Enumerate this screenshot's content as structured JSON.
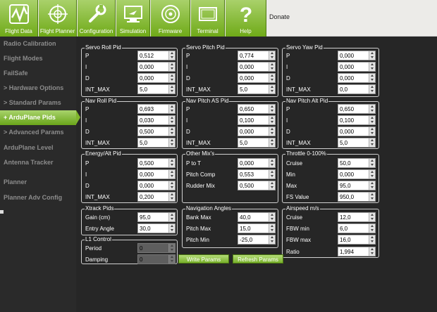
{
  "colors": {
    "accent": "#7fb52c",
    "background": "#262626",
    "sidebar_text": "#8c8c8c"
  },
  "toolbar": {
    "buttons": [
      {
        "label": "Flight Data",
        "icon": "flight-data-icon"
      },
      {
        "label": "Flight Planner",
        "icon": "flight-planner-icon"
      },
      {
        "label": "Configuration",
        "icon": "configuration-icon"
      },
      {
        "label": "Simulation",
        "icon": "simulation-icon"
      },
      {
        "label": "Firmware",
        "icon": "firmware-icon"
      },
      {
        "label": "Terminal",
        "icon": "terminal-icon"
      },
      {
        "label": "Help",
        "icon": "help-icon"
      }
    ],
    "donate": "Donate"
  },
  "sidebar": {
    "items": [
      {
        "label": "Radio Calibration"
      },
      {
        "label": "Flight Modes"
      },
      {
        "label": "FailSafe"
      },
      {
        "label": "> Hardware Options"
      },
      {
        "label": "> Standard Params"
      },
      {
        "label": "+ ArduPlane Pids",
        "active": true
      },
      {
        "label": "> Advanced Params"
      },
      {
        "label": "ArduPlane Level"
      },
      {
        "label": "Antenna Tracker"
      },
      {
        "label": "Planner"
      },
      {
        "label": "Planner Adv Config"
      }
    ]
  },
  "panels": {
    "servo_roll": {
      "title": "Servo Roll Pid",
      "rows": [
        {
          "label": "P",
          "value": "0,512"
        },
        {
          "label": "I",
          "value": "0,000"
        },
        {
          "label": "D",
          "value": "0,000"
        },
        {
          "label": "INT_MAX",
          "value": "5,0"
        }
      ]
    },
    "servo_pitch": {
      "title": "Servo Pitch Pid",
      "rows": [
        {
          "label": "P",
          "value": "0,774"
        },
        {
          "label": "I",
          "value": "0,000"
        },
        {
          "label": "D",
          "value": "0,000"
        },
        {
          "label": "INT_MAX",
          "value": "5,0"
        }
      ]
    },
    "servo_yaw": {
      "title": "Servo Yaw Pid",
      "rows": [
        {
          "label": "P",
          "value": "0,000"
        },
        {
          "label": "I",
          "value": "0,000"
        },
        {
          "label": "D",
          "value": "0,000"
        },
        {
          "label": "INT_MAX",
          "value": "0,0"
        }
      ]
    },
    "nav_roll": {
      "title": "Nav Roll Pid",
      "rows": [
        {
          "label": "P",
          "value": "0,693"
        },
        {
          "label": "I",
          "value": "0,030"
        },
        {
          "label": "D",
          "value": "0,500"
        },
        {
          "label": "INT_MAX",
          "value": "5,0"
        }
      ]
    },
    "nav_pitch_as": {
      "title": "Nav Pitch AS Pid",
      "rows": [
        {
          "label": "P",
          "value": "0,650"
        },
        {
          "label": "I",
          "value": "0,100"
        },
        {
          "label": "D",
          "value": "0,000"
        },
        {
          "label": "INT_MAX",
          "value": "5,0"
        }
      ]
    },
    "nav_pitch_alt": {
      "title": "Nav Pitch Alt Pid",
      "rows": [
        {
          "label": "P",
          "value": "0,650"
        },
        {
          "label": "I",
          "value": "0,100"
        },
        {
          "label": "D",
          "value": "0,000"
        },
        {
          "label": "INT_MAX",
          "value": "5,0"
        }
      ]
    },
    "energy_alt": {
      "title": "Energy/Alt Pid",
      "rows": [
        {
          "label": "P",
          "value": "0,500"
        },
        {
          "label": "I",
          "value": "0,000"
        },
        {
          "label": "D",
          "value": "0,000"
        },
        {
          "label": "INT_MAX",
          "value": "0,200"
        }
      ]
    },
    "other_mix": {
      "title": "Other Mix's",
      "rows": [
        {
          "label": "P to T",
          "value": "0,000"
        },
        {
          "label": "Pitch Comp",
          "value": "0,553"
        },
        {
          "label": "Rudder Mix",
          "value": "0,500"
        }
      ]
    },
    "throttle": {
      "title": "Throttle 0-100%",
      "rows": [
        {
          "label": "Cruise",
          "value": "50,0"
        },
        {
          "label": "Min",
          "value": "0,000"
        },
        {
          "label": "Max",
          "value": "95,0"
        },
        {
          "label": "FS Value",
          "value": "950,0"
        }
      ]
    },
    "xtrack": {
      "title": "Xtrack Pids",
      "rows": [
        {
          "label": "Gain (cm)",
          "value": "95,0"
        },
        {
          "label": "Entry Angle",
          "value": "30,0"
        }
      ]
    },
    "nav_angles": {
      "title": "Navigation Angles",
      "rows": [
        {
          "label": "Bank Max",
          "value": "40,0"
        },
        {
          "label": "Pitch Max",
          "value": "15,0"
        },
        {
          "label": "Pitch Min",
          "value": "-25,0"
        }
      ]
    },
    "airspeed": {
      "title": "Airspeed m/s",
      "rows": [
        {
          "label": "Cruise",
          "value": "12,0"
        },
        {
          "label": "FBW min",
          "value": "6,0"
        },
        {
          "label": "FBW max",
          "value": "16,0"
        },
        {
          "label": "Ratio",
          "value": "1,994"
        }
      ]
    },
    "l1": {
      "title": "L1 Control",
      "rows": [
        {
          "label": "Period",
          "value": "0"
        },
        {
          "label": "Damping",
          "value": "0"
        }
      ]
    }
  },
  "actions": {
    "write_params": "Write Params",
    "refresh_params": "Refresh Params"
  }
}
